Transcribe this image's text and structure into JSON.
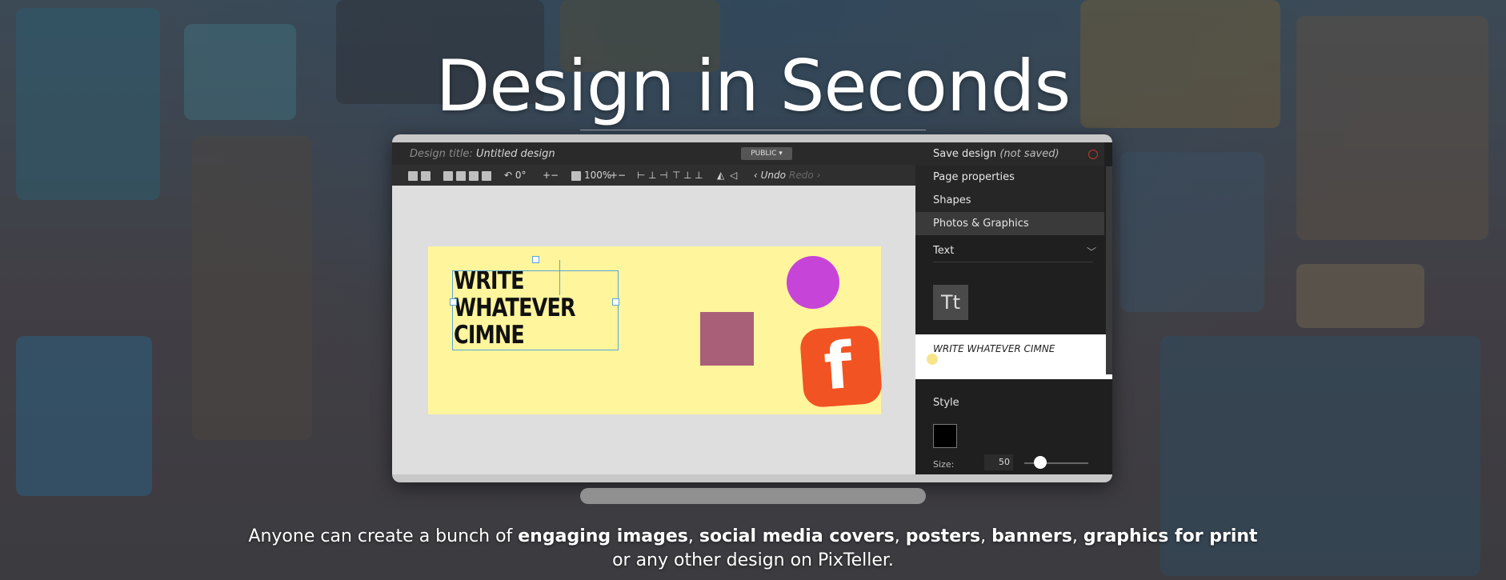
{
  "hero": {
    "title": "Design in Seconds"
  },
  "editor": {
    "design_title_label": "Design title:",
    "design_title_value": "Untitled design",
    "visibility_badge": "PUBLIC",
    "toolbar": {
      "rotation": "0°",
      "zoom": "100%",
      "undo": "Undo",
      "redo": "Redo"
    },
    "canvas_text": [
      "WRITE",
      "WHATEVER",
      "CIMNE"
    ],
    "facebook_glyph": "f",
    "colors": {
      "canvas_bg": "#fff59c",
      "circle": "#c744d8",
      "square": "#a86078",
      "facebook": "#f25322"
    }
  },
  "panel": {
    "save_label": "Save design",
    "save_status": "(not saved)",
    "items": [
      "Page properties",
      "Shapes",
      "Photos & Graphics"
    ],
    "text_section": "Text",
    "text_icon": "Tt",
    "text_input_value": "WRITE WHATEVER CIMNE",
    "style_section": "Style",
    "size_label": "Size:",
    "size_value": "50"
  },
  "description": {
    "intro": "Anyone can create a bunch of ",
    "t1": "engaging images",
    "sep1": ", ",
    "t2": "social media covers",
    "sep2": ", ",
    "t3": "posters",
    "sep3": ", ",
    "t4": "banners",
    "sep4": ", ",
    "t5": "graphics for print",
    "line2": "or any other design on PixTeller."
  }
}
